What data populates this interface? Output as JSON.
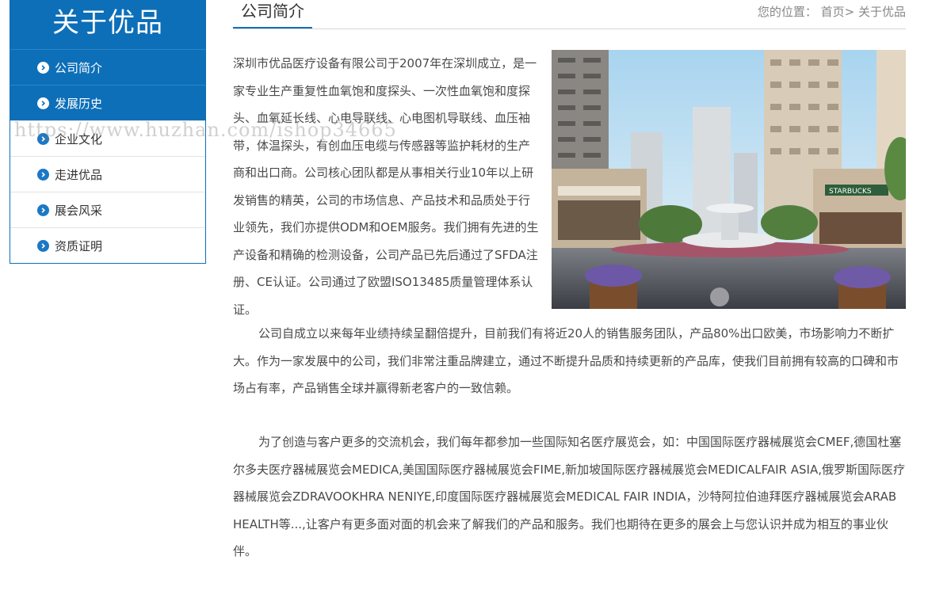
{
  "sidebar": {
    "title": "关于优品",
    "items": [
      {
        "label": "公司简介",
        "active": true
      },
      {
        "label": "发展历史",
        "active": true
      },
      {
        "label": "企业文化",
        "active": false
      },
      {
        "label": "走进优品",
        "active": false
      },
      {
        "label": "展会风采",
        "active": false
      },
      {
        "label": "资质证明",
        "active": false
      }
    ]
  },
  "header": {
    "title": "公司简介",
    "breadcrumb_prefix": "您的位置：",
    "breadcrumb_home": "首页",
    "breadcrumb_sep": ">",
    "breadcrumb_current": "关于优品"
  },
  "content": {
    "intro": "深圳市优品医疗设备有限公司于2007年在深圳成立，是一家专业生产重复性血氧饱和度探头、一次性血氧饱和度探头、血氧延长线、心电导联线、心电图机导联线、血压袖带，体温探头，有创血压电缆与传感器等监护耗材的生产商和出口商。公司核心团队都是从事相关行业10年以上研发销售的精英，公司的市场信息、产品技术和品质处于行业领先，我们亦提供ODM和OEM服务。我们拥有先进的生产设备和精确的检测设备，公司产品已先后通过了SFDA注册、CE认证。公司通过了欧盟ISO13485质量管理体系认证。",
    "para2": "公司自成立以来每年业绩持续呈翻倍提升，目前我们有将近20人的销售服务团队，产品80%出口欧美，市场影响力不断扩大。作为一家发展中的公司，我们非常注重品牌建立，通过不断提升品质和持续更新的产品库，使我们目前拥有较高的口碑和市场占有率，产品销售全球并赢得新老客户的一致信赖。",
    "para3": "为了创造与客户更多的交流机会，我们每年都参加一些国际知名医疗展览会，如：中国国际医疗器械展览会CMEF,德国杜塞尔多夫医疗器械展览会MEDICA,美国国际医疗器械展览会FIME,新加坡国际医疗器械展览会MEDICALFAIR ASIA,俄罗斯国际医疗器械展览会ZDRAVOOKHRA NENIYE,印度国际医疗器械展览会MEDICAL FAIR INDIA，沙特阿拉伯迪拜医疗器械展览会ARAB HEALTH等...,让客户有更多面对面的机会来了解我们的产品和服务。我们也期待在更多的展会上与您认识并成为相互的事业伙伴。",
    "photo_sign": "STARBUCKS"
  },
  "watermark": "https://www.huzhan.com/ishop34665",
  "colors": {
    "accent": "#0d6fb8",
    "text": "#4a4a4a",
    "muted": "#888888"
  }
}
